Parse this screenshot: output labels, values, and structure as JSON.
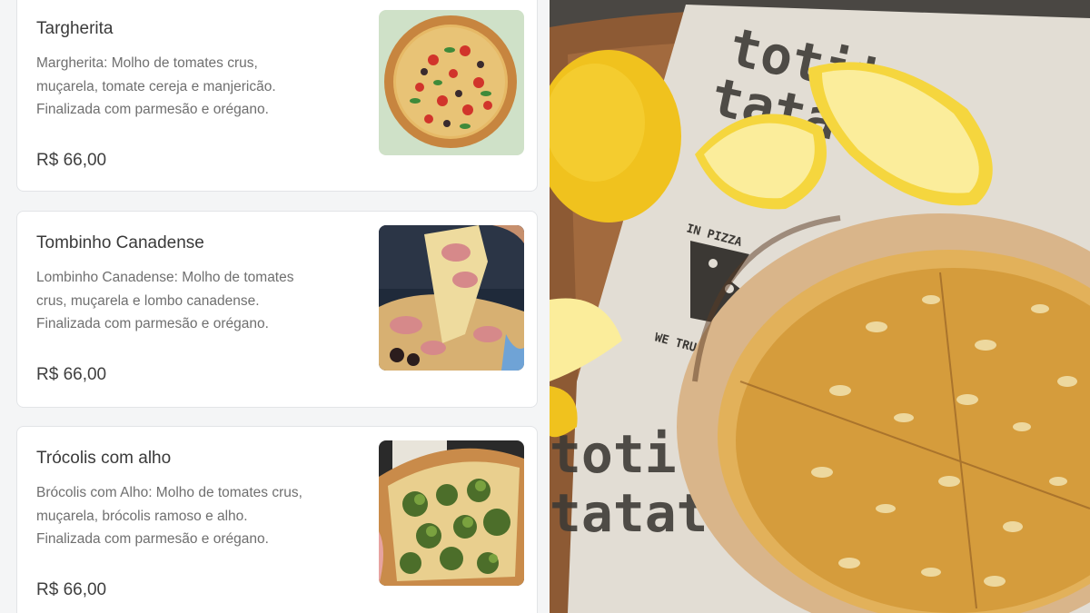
{
  "menu": {
    "items": [
      {
        "name": "Targherita",
        "description_lines": [
          "Margherita: Molho de tomates crus,",
          "muçarela, tomate cereja e manjericão.",
          "Finalizada com parmesão e orégano."
        ],
        "price": "R$ 66,00"
      },
      {
        "name": "Tombinho Canadense",
        "description_lines": [
          "Lombinho Canadense: Molho de tomates",
          "crus, muçarela e lombo canadense.",
          "Finalizada com parmesão e orégano."
        ],
        "price": "R$ 66,00"
      },
      {
        "name": "Trócolis com alho",
        "description_lines": [
          "Brócolis com Alho: Molho de tomates crus,",
          "muçarela, brócolis ramoso e alho.",
          "Finalizada com parmesão e orégano."
        ],
        "price": "R$ 66,00"
      }
    ]
  },
  "photo": {
    "paper_logo_top": "IN PIZZA",
    "paper_logo_bottom": "WE TRU",
    "paper_pattern_words": [
      "totit",
      "tatat",
      "totit",
      "tatat"
    ]
  }
}
